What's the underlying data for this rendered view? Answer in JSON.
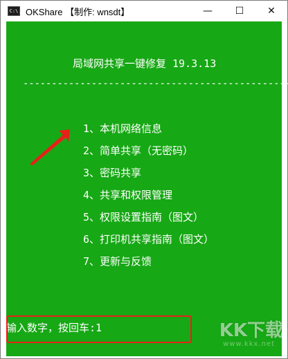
{
  "window": {
    "title": "OKShare 【制作: wnsdt】",
    "icon_text": "C:\\",
    "minimize_glyph": "—",
    "maximize_glyph": "☐",
    "close_glyph": "✕"
  },
  "console": {
    "background": "#17a815",
    "heading": "局域网共享一键修复 19.3.13",
    "divider": "-----------------------------------------------",
    "menu": [
      {
        "label": "1、本机网络信息"
      },
      {
        "label": "2、简单共享（无密码）"
      },
      {
        "label": "3、密码共享"
      },
      {
        "label": "4、共享和权限管理"
      },
      {
        "label": "5、权限设置指南（图文）"
      },
      {
        "label": "6、打印机共享指南（图文）"
      },
      {
        "label": "7、更新与反馈"
      }
    ],
    "prompt": "输入数字，按回车:1"
  },
  "annotations": {
    "arrow_color": "#e8201a",
    "highlight_color": "#e8201a"
  },
  "watermark": {
    "brand": "KK下载",
    "url": "www.kkx.net"
  }
}
